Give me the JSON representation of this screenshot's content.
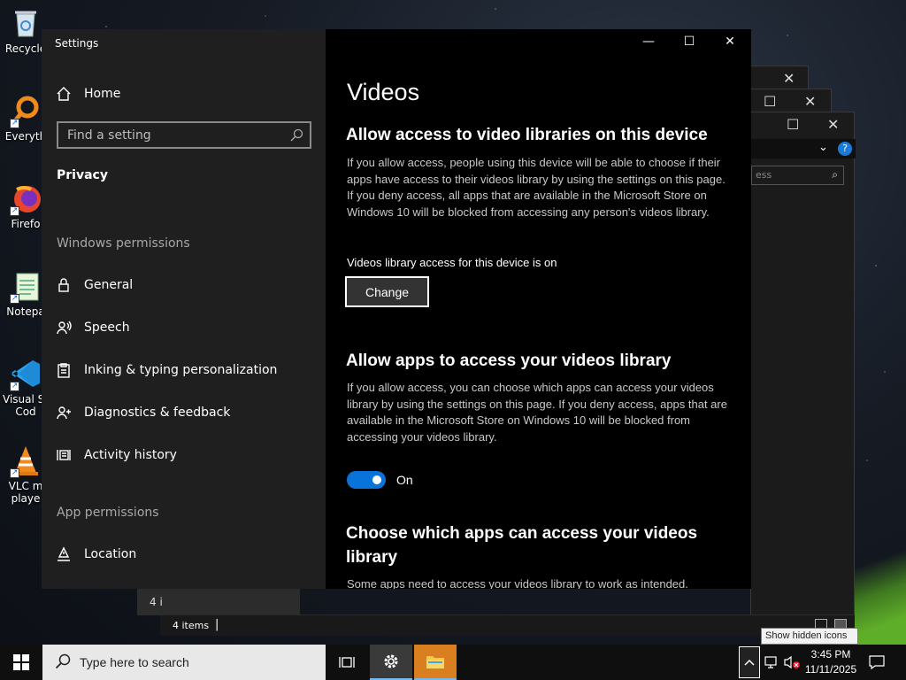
{
  "desktop": {
    "icons": [
      {
        "label": "Recycle",
        "icon": "recycle-bin-icon"
      },
      {
        "label": "Everyth",
        "icon": "everything-search-icon"
      },
      {
        "label": "Firefo",
        "icon": "firefox-icon"
      },
      {
        "label": "Notepa",
        "icon": "notepad-icon"
      },
      {
        "label": "Visual St",
        "label2": "Cod",
        "icon": "vscode-icon"
      },
      {
        "label": "VLC m",
        "label2": "playe",
        "icon": "vlc-icon"
      }
    ]
  },
  "background_window": {
    "search_placeholder": "ess",
    "status_items": "4 items",
    "fragment_text": "4 i"
  },
  "settings": {
    "window_title": "Settings",
    "home_label": "Home",
    "search_placeholder": "Find a setting",
    "active_section": "Privacy",
    "windows_permissions_label": "Windows permissions",
    "nav": [
      {
        "label": "General",
        "icon": "lock-icon"
      },
      {
        "label": "Speech",
        "icon": "speech-icon"
      },
      {
        "label": "Inking & typing personalization",
        "icon": "clipboard-icon"
      },
      {
        "label": "Diagnostics & feedback",
        "icon": "diagnostics-icon"
      },
      {
        "label": "Activity history",
        "icon": "activity-history-icon"
      }
    ],
    "app_permissions_label": "App permissions",
    "app_nav": [
      {
        "label": "Location",
        "icon": "location-icon"
      }
    ],
    "content": {
      "page_title": "Videos",
      "section1_heading": "Allow access to video libraries on this device",
      "section1_body": "If you allow access, people using this device will be able to choose if their apps have access to their videos library by using the settings on this page. If you deny access, all apps that are available in the Microsoft Store on Windows 10 will be blocked from accessing any person's videos library.",
      "device_status": "Videos library access for this device is on",
      "change_button": "Change",
      "section2_heading": "Allow apps to access your videos library",
      "section2_body": "If you allow access, you can choose which apps can access your videos library by using the settings on this page. If you deny access, apps that are available in the Microsoft Store on Windows 10 will be blocked from accessing your videos library.",
      "toggle_state": "On",
      "toggle_on": true,
      "section3_heading": "Choose which apps can access your videos library",
      "section3_body": "Some apps need to access your videos library to work as intended."
    }
  },
  "taskbar": {
    "search_placeholder": "Type here to search",
    "tooltip": "Show hidden icons",
    "time": "3:45 PM",
    "date": "11/11/2025"
  },
  "colors": {
    "accent": "#0a73d9",
    "sidebar_bg": "#1f1f1f",
    "content_bg": "#000000",
    "taskbar_bg": "#0f0f0f"
  }
}
